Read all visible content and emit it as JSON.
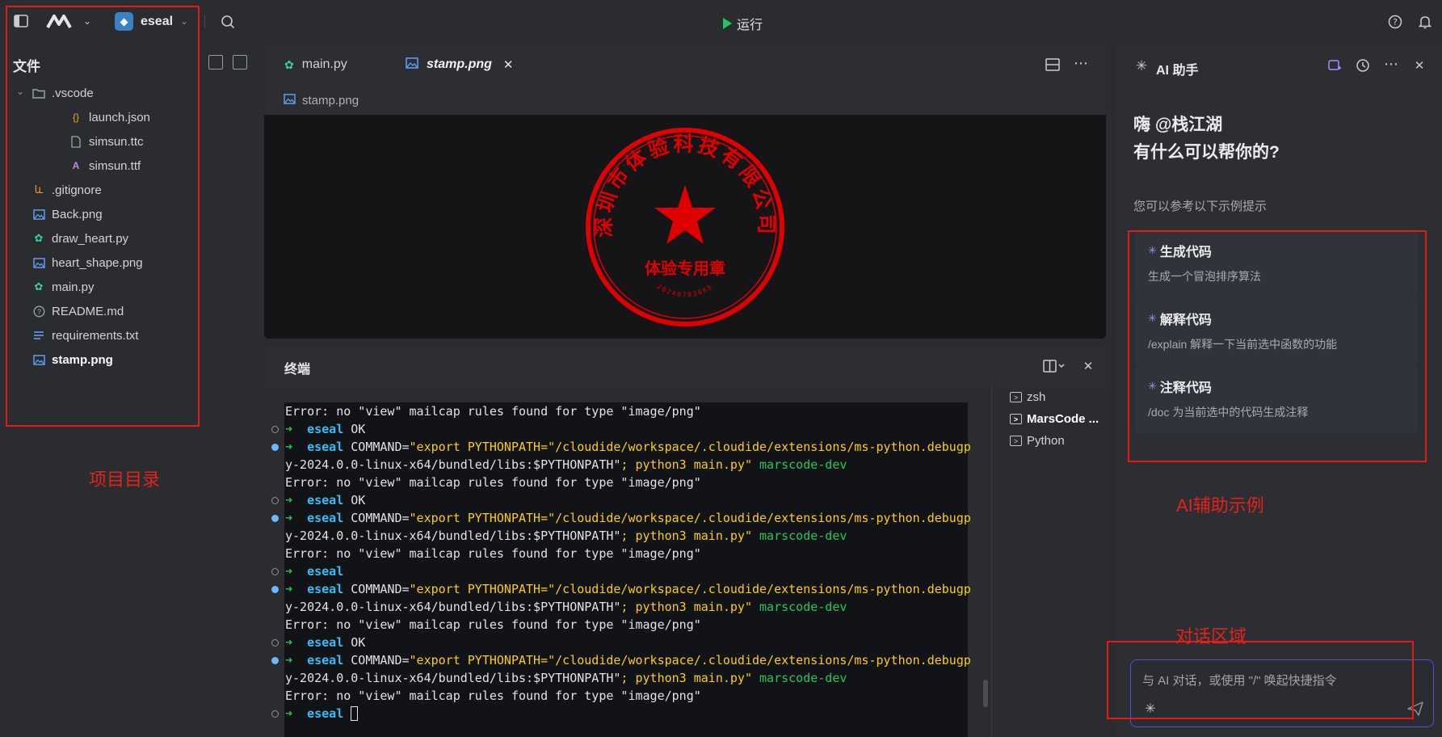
{
  "topbar": {
    "project_name": "eseal",
    "run_label": "运行",
    "icons": [
      "sidebar-toggle-icon",
      "marscode-logo-icon",
      "chevron-down-icon",
      "python-icon",
      "search-icon",
      "play-icon",
      "help-icon",
      "bell-icon"
    ]
  },
  "sidebar": {
    "title": "文件",
    "items": [
      {
        "label": ".vscode",
        "icon": "folder-icon",
        "type": "folder"
      },
      {
        "label": "launch.json",
        "icon": "json-icon",
        "type": "file"
      },
      {
        "label": "simsun.ttc",
        "icon": "file-icon",
        "type": "file"
      },
      {
        "label": "simsun.ttf",
        "icon": "font-icon",
        "type": "file"
      },
      {
        "label": ".gitignore",
        "icon": "git-icon",
        "type": "file"
      },
      {
        "label": "Back.png",
        "icon": "image-icon",
        "type": "file"
      },
      {
        "label": "draw_heart.py",
        "icon": "python-file-icon",
        "type": "file"
      },
      {
        "label": "heart_shape.png",
        "icon": "image-icon",
        "type": "file"
      },
      {
        "label": "main.py",
        "icon": "python-file-icon",
        "type": "file"
      },
      {
        "label": "README.md",
        "icon": "info-icon",
        "type": "file"
      },
      {
        "label": "requirements.txt",
        "icon": "text-file-icon",
        "type": "file"
      },
      {
        "label": "stamp.png",
        "icon": "image-icon",
        "type": "file",
        "active": true
      }
    ],
    "annotation": "项目目录"
  },
  "editor": {
    "tabs": [
      {
        "label": "main.py",
        "icon": "python-file-icon"
      },
      {
        "label": "stamp.png",
        "icon": "image-icon",
        "active": true
      }
    ],
    "breadcrumb": "stamp.png",
    "stamp": {
      "company_text": "深圳市体验科技有限公司",
      "center_text": "体验专用章",
      "serial": "20240703068",
      "color": "#e00000"
    }
  },
  "terminal": {
    "title": "终端",
    "lines": [
      {
        "kind": "error",
        "gutter": "none",
        "text": "Error: no \"view\" mailcap rules found for type \"image/png\""
      },
      {
        "kind": "prompt",
        "gutter": "hollow",
        "cwd": "eseal",
        "rest": " OK"
      },
      {
        "kind": "cmd",
        "gutter": "dot",
        "cwd": "eseal",
        "cmd_prefix": " COMMAND=",
        "str1": "\"export PYTHONPATH=\"/cloudide/workspace/.cloudide/extensions/ms-python.debugp"
      },
      {
        "kind": "cont",
        "gutter": "none",
        "part1": "y-2024.0.0-linux-x64/bundled/libs:$PYTHONPATH\"",
        "part2": "; python3 main.py\"",
        "host": " marscode-dev"
      },
      {
        "kind": "error",
        "gutter": "none",
        "text": "Error: no \"view\" mailcap rules found for type \"image/png\""
      },
      {
        "kind": "prompt",
        "gutter": "hollow",
        "cwd": "eseal",
        "rest": " OK"
      },
      {
        "kind": "cmd",
        "gutter": "dot",
        "cwd": "eseal",
        "cmd_prefix": " COMMAND=",
        "str1": "\"export PYTHONPATH=\"/cloudide/workspace/.cloudide/extensions/ms-python.debugp"
      },
      {
        "kind": "cont",
        "gutter": "none",
        "part1": "y-2024.0.0-linux-x64/bundled/libs:$PYTHONPATH\"",
        "part2": "; python3 main.py\"",
        "host": " marscode-dev"
      },
      {
        "kind": "error",
        "gutter": "none",
        "text": "Error: no \"view\" mailcap rules found for type \"image/png\""
      },
      {
        "kind": "prompt",
        "gutter": "hollow",
        "cwd": "eseal",
        "rest": ""
      },
      {
        "kind": "cmd",
        "gutter": "dot",
        "cwd": "eseal",
        "cmd_prefix": " COMMAND=",
        "str1": "\"export PYTHONPATH=\"/cloudide/workspace/.cloudide/extensions/ms-python.debugp"
      },
      {
        "kind": "cont",
        "gutter": "none",
        "part1": "y-2024.0.0-linux-x64/bundled/libs:$PYTHONPATH\"",
        "part2": "; python3 main.py\"",
        "host": " marscode-dev"
      },
      {
        "kind": "error",
        "gutter": "none",
        "text": "Error: no \"view\" mailcap rules found for type \"image/png\""
      },
      {
        "kind": "prompt",
        "gutter": "hollow",
        "cwd": "eseal",
        "rest": " OK"
      },
      {
        "kind": "cmd",
        "gutter": "dot",
        "cwd": "eseal",
        "cmd_prefix": " COMMAND=",
        "str1": "\"export PYTHONPATH=\"/cloudide/workspace/.cloudide/extensions/ms-python.debugp"
      },
      {
        "kind": "cont",
        "gutter": "none",
        "part1": "y-2024.0.0-linux-x64/bundled/libs:$PYTHONPATH\"",
        "part2": "; python3 main.py\"",
        "host": " marscode-dev"
      },
      {
        "kind": "error",
        "gutter": "none",
        "text": "Error: no \"view\" mailcap rules found for type \"image/png\""
      },
      {
        "kind": "prompt",
        "gutter": "hollow",
        "cwd": "eseal",
        "rest": "",
        "cursor": true
      }
    ],
    "sessions": [
      {
        "label": "zsh"
      },
      {
        "label": "MarsCode ...",
        "active": true
      },
      {
        "label": "Python"
      }
    ]
  },
  "ai": {
    "title": "AI 助手",
    "greeting_line1": "嗨 @栈江湖",
    "greeting_line2": "有什么可以帮你的?",
    "hint": "您可以参考以下示例提示",
    "cards": [
      {
        "title": "生成代码",
        "desc": "生成一个冒泡排序算法"
      },
      {
        "title": "解释代码",
        "desc": "/explain 解释一下当前选中函数的功能"
      },
      {
        "title": "注释代码",
        "desc": "/doc 为当前选中的代码生成注释"
      }
    ],
    "examples_annotation": "AI辅助示例",
    "chat_annotation": "对话区域",
    "input_placeholder": "与 AI 对话，或使用 \"/\" 唤起快捷指令"
  },
  "colors": {
    "accent_red": "#e2231a",
    "run_green": "#22c55e",
    "prompt_cyan": "#38bdf8"
  }
}
